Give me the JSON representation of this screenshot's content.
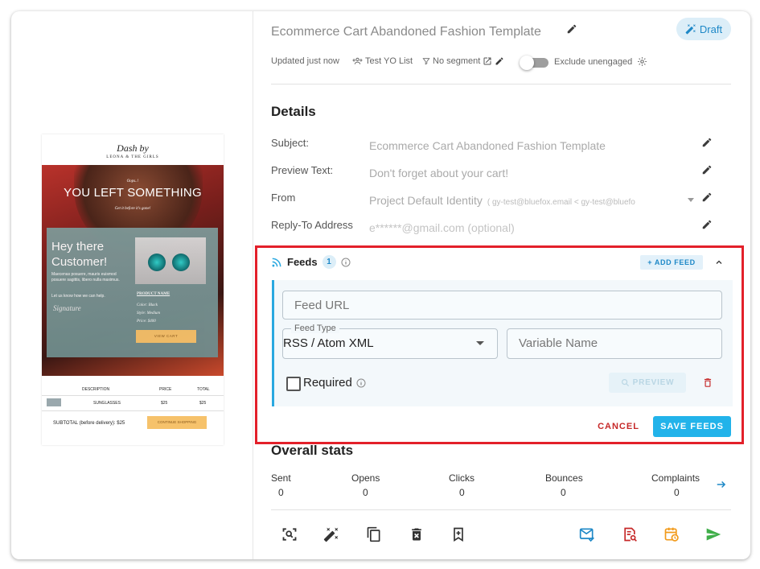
{
  "campaign": {
    "title": "Ecommerce Cart Abandoned Fashion Template",
    "status": "Draft",
    "updated": "Updated just now",
    "list": "Test YO List",
    "segment": "No segment",
    "exclude_label": "Exclude unengaged"
  },
  "details": {
    "heading": "Details",
    "rows": [
      {
        "label": "Subject:",
        "value": "Ecommerce Cart Abandoned Fashion Template"
      },
      {
        "label": "Preview Text:",
        "value": "Don't forget about your cart!"
      },
      {
        "label": "From",
        "value": "Project Default Identity",
        "extra": "( gy-test@bluefox.email < gy-test@bluefo"
      },
      {
        "label": "Reply-To Address",
        "value": "e******@gmail.com (optional)"
      }
    ]
  },
  "feeds": {
    "heading": "Feeds",
    "count": "1",
    "add_label": "+ ADD FEED",
    "url_placeholder": "Feed URL",
    "type_label": "Feed Type",
    "type_value": "RSS / Atom XML",
    "var_placeholder": "Variable Name",
    "required_label": "Required",
    "preview_label": "PREVIEW",
    "cancel_label": "CANCEL",
    "save_label": "SAVE FEEDS"
  },
  "stats": {
    "heading": "Overall stats",
    "items": [
      {
        "label": "Sent",
        "value": "0"
      },
      {
        "label": "Opens",
        "value": "0"
      },
      {
        "label": "Clicks",
        "value": "0"
      },
      {
        "label": "Bounces",
        "value": "0"
      },
      {
        "label": "Complaints",
        "value": "0"
      }
    ]
  },
  "email_preview": {
    "brand": "Dash by",
    "brand_sub": "LEONA & THE GIRLS",
    "oops": "Oops..!",
    "headline": "YOU LEFT SOMETHING",
    "subline": "Get it before it's gone!",
    "hey": "Hey there Customer!",
    "body": "Maecenas posuere, mauris euismod posuere sagittis, libero nulla maximus.",
    "body2": "Let us know how we can help.",
    "signature": "Signature",
    "product_name": "PRODUCT NAME",
    "product_color": "Color: Black",
    "product_style": "Style: Medium",
    "product_price": "Price: $400",
    "view_cart": "VIEW CART",
    "col_desc": "DESCRIPTION",
    "col_price": "PRICE",
    "col_total": "TOTAL",
    "item_name": "SUNGLASSES",
    "item_price": "$25",
    "item_total": "$25",
    "subtotal": "SUBTOTAL (before delivery): $25",
    "continue": "CONTINUE SHOPPING"
  },
  "colors": {
    "accent": "#22b3ea",
    "danger": "#c62828",
    "highlight": "#e3202a"
  }
}
